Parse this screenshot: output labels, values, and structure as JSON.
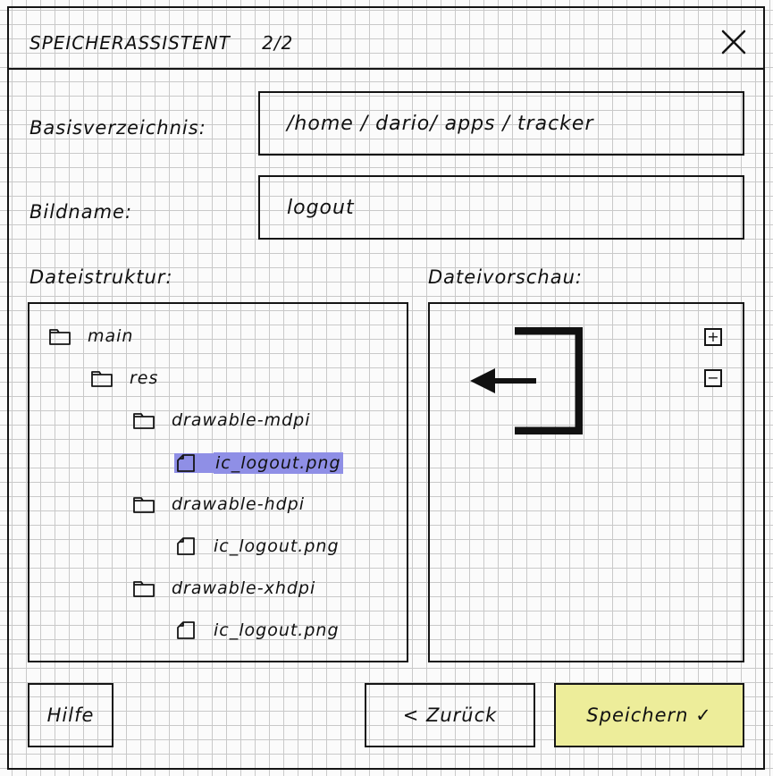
{
  "window": {
    "title": "SPEICHERASSISTENT",
    "step": "2/2"
  },
  "form": {
    "base_dir_label": "Basisverzeichnis:",
    "base_dir_value": "/home / dario/ apps / tracker",
    "image_name_label": "Bildname:",
    "image_name_value": "logout"
  },
  "structure": {
    "label": "Dateistruktur:",
    "items": [
      {
        "type": "folder",
        "name": "main",
        "depth": 0
      },
      {
        "type": "folder",
        "name": "res",
        "depth": 1
      },
      {
        "type": "folder",
        "name": "drawable-mdpi",
        "depth": 2
      },
      {
        "type": "file",
        "name": "ic_logout.png",
        "depth": 3,
        "selected": true
      },
      {
        "type": "folder",
        "name": "drawable-hdpi",
        "depth": 2
      },
      {
        "type": "file",
        "name": "ic_logout.png",
        "depth": 3
      },
      {
        "type": "folder",
        "name": "drawable-xhdpi",
        "depth": 2
      },
      {
        "type": "file",
        "name": "ic_logout.png",
        "depth": 3
      }
    ]
  },
  "preview": {
    "label": "Dateivorschau:",
    "zoom_in": "+",
    "zoom_out": "−",
    "icon": "logout-icon"
  },
  "buttons": {
    "help": "Hilfe",
    "back": "<  Zurück",
    "save": "Speichern ✓",
    "save_color": "#eded9a"
  }
}
